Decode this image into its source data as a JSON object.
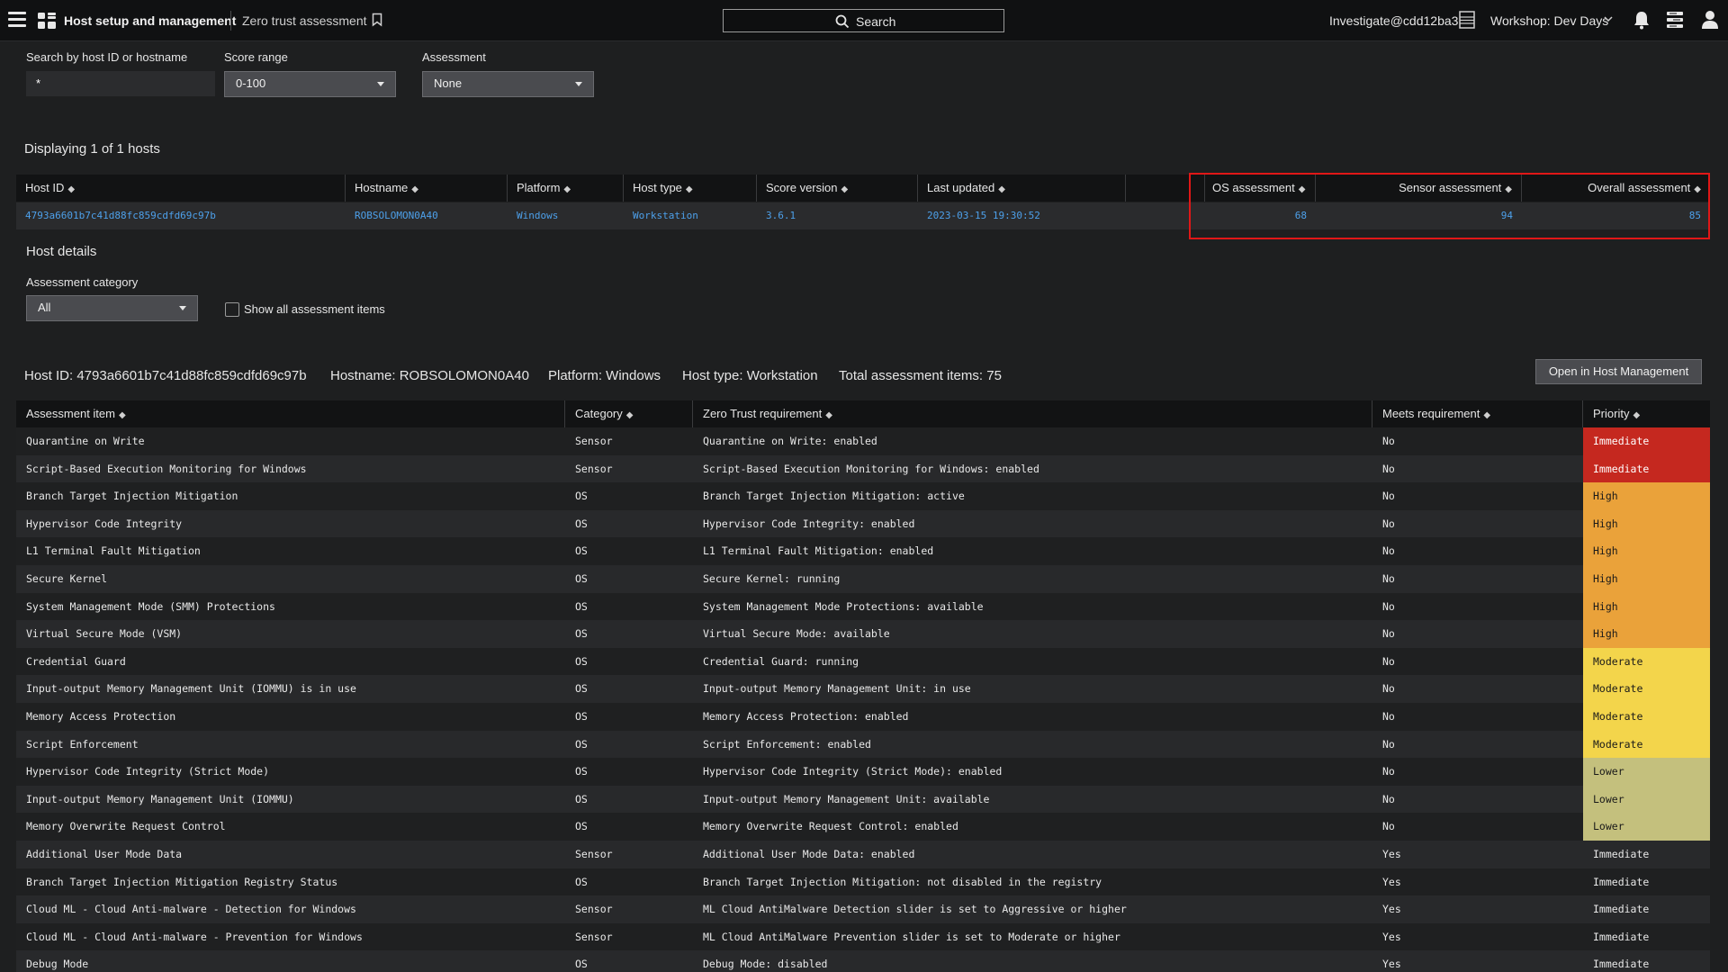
{
  "topbar": {
    "app_title": "Host setup and management",
    "page_name": "Zero trust assessment",
    "search_label": "Search",
    "user": "Investigate@cdd12ba3",
    "workshop": "Workshop: Dev Days"
  },
  "filters": {
    "search_label": "Search by host ID or hostname",
    "search_value": "*",
    "score_label": "Score range",
    "score_value": "0-100",
    "assessment_label": "Assessment",
    "assessment_value": "None"
  },
  "display_count": "Displaying 1 of 1 hosts",
  "hosts": {
    "headers": [
      "Host ID",
      "Hostname",
      "Platform",
      "Host type",
      "Score version",
      "Last updated",
      "OS assessment",
      "Sensor assessment",
      "Overall assessment"
    ],
    "row": {
      "host_id": "4793a6601b7c41d88fc859cdfd69c97b",
      "hostname": "ROBSOLOMON0A40",
      "platform": "Windows",
      "host_type": "Workstation",
      "score_version": "3.6.1",
      "last_updated": "2023-03-15 19:30:52",
      "os_assessment": "68",
      "sensor_assessment": "94",
      "overall_assessment": "85"
    }
  },
  "host_details": {
    "title": "Host details",
    "category_label": "Assessment category",
    "category_value": "All",
    "show_all_label": "Show all assessment items",
    "summary_host_id": "Host ID: 4793a6601b7c41d88fc859cdfd69c97b",
    "summary_hostname": "Hostname: ROBSOLOMON0A40",
    "summary_platform": "Platform: Windows",
    "summary_host_type": "Host type: Workstation",
    "summary_total": "Total assessment items: 75",
    "open_button": "Open in Host Management"
  },
  "assessment": {
    "headers": [
      "Assessment item",
      "Category",
      "Zero Trust requirement",
      "Meets requirement",
      "Priority"
    ],
    "rows": [
      {
        "item": "Quarantine on Write",
        "category": "Sensor",
        "requirement": "Quarantine on Write: enabled",
        "meets": "No",
        "priority": "Immediate",
        "level": "immediate-hl"
      },
      {
        "item": "Script-Based Execution Monitoring for Windows",
        "category": "Sensor",
        "requirement": "Script-Based Execution Monitoring for Windows: enabled",
        "meets": "No",
        "priority": "Immediate",
        "level": "immediate-hl"
      },
      {
        "item": "Branch Target Injection Mitigation",
        "category": "OS",
        "requirement": "Branch Target Injection Mitigation: active",
        "meets": "No",
        "priority": "High",
        "level": "high"
      },
      {
        "item": "Hypervisor Code Integrity",
        "category": "OS",
        "requirement": "Hypervisor Code Integrity: enabled",
        "meets": "No",
        "priority": "High",
        "level": "high"
      },
      {
        "item": "L1 Terminal Fault Mitigation",
        "category": "OS",
        "requirement": "L1 Terminal Fault Mitigation: enabled",
        "meets": "No",
        "priority": "High",
        "level": "high"
      },
      {
        "item": "Secure Kernel",
        "category": "OS",
        "requirement": "Secure Kernel: running",
        "meets": "No",
        "priority": "High",
        "level": "high"
      },
      {
        "item": "System Management Mode (SMM) Protections",
        "category": "OS",
        "requirement": "System Management Mode Protections: available",
        "meets": "No",
        "priority": "High",
        "level": "high"
      },
      {
        "item": "Virtual Secure Mode (VSM)",
        "category": "OS",
        "requirement": "Virtual Secure Mode: available",
        "meets": "No",
        "priority": "High",
        "level": "high"
      },
      {
        "item": "Credential Guard",
        "category": "OS",
        "requirement": "Credential Guard: running",
        "meets": "No",
        "priority": "Moderate",
        "level": "moderate"
      },
      {
        "item": "Input-output Memory Management Unit (IOMMU) is in use",
        "category": "OS",
        "requirement": "Input-output Memory Management Unit: in use",
        "meets": "No",
        "priority": "Moderate",
        "level": "moderate"
      },
      {
        "item": "Memory Access Protection",
        "category": "OS",
        "requirement": "Memory Access Protection: enabled",
        "meets": "No",
        "priority": "Moderate",
        "level": "moderate"
      },
      {
        "item": "Script Enforcement",
        "category": "OS",
        "requirement": "Script Enforcement: enabled",
        "meets": "No",
        "priority": "Moderate",
        "level": "moderate"
      },
      {
        "item": "Hypervisor Code Integrity (Strict Mode)",
        "category": "OS",
        "requirement": "Hypervisor Code Integrity (Strict Mode): enabled",
        "meets": "No",
        "priority": "Lower",
        "level": "lower"
      },
      {
        "item": "Input-output Memory Management Unit (IOMMU)",
        "category": "OS",
        "requirement": "Input-output Memory Management Unit: available",
        "meets": "No",
        "priority": "Lower",
        "level": "lower"
      },
      {
        "item": "Memory Overwrite Request Control",
        "category": "OS",
        "requirement": "Memory Overwrite Request Control: enabled",
        "meets": "No",
        "priority": "Lower",
        "level": "lower"
      },
      {
        "item": "Additional User Mode Data",
        "category": "Sensor",
        "requirement": "Additional User Mode Data: enabled",
        "meets": "Yes",
        "priority": "Immediate",
        "level": "plain"
      },
      {
        "item": "Branch Target Injection Mitigation Registry Status",
        "category": "OS",
        "requirement": "Branch Target Injection Mitigation: not disabled in the registry",
        "meets": "Yes",
        "priority": "Immediate",
        "level": "plain"
      },
      {
        "item": "Cloud ML - Cloud Anti-malware - Detection for Windows",
        "category": "Sensor",
        "requirement": "ML Cloud AntiMalware Detection slider is set to Aggressive or higher",
        "meets": "Yes",
        "priority": "Immediate",
        "level": "plain"
      },
      {
        "item": "Cloud ML - Cloud Anti-malware - Prevention for Windows",
        "category": "Sensor",
        "requirement": "ML Cloud AntiMalware Prevention slider is set to Moderate or higher",
        "meets": "Yes",
        "priority": "Immediate",
        "level": "plain"
      },
      {
        "item": "Debug Mode",
        "category": "OS",
        "requirement": "Debug Mode: disabled",
        "meets": "Yes",
        "priority": "Immediate",
        "level": "plain"
      }
    ]
  }
}
